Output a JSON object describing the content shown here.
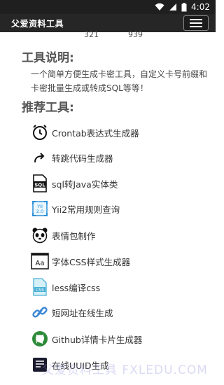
{
  "status": {
    "time": "4:02"
  },
  "appbar": {
    "title": "父爱资料工具"
  },
  "counts": [
    "321",
    "939"
  ],
  "intro": {
    "heading": "工具说明:",
    "text": "一个简单方便生成卡密工具，自定义卡号前缀和卡密批量生成或转成SQL等等！"
  },
  "tools_heading": "推荐工具:",
  "tools": [
    {
      "label": "Crontab表达式生成器",
      "icon": "clock-icon"
    },
    {
      "label": "转跳代码生成器",
      "icon": "redirect-arrow-icon"
    },
    {
      "label": "sql转Java实体类",
      "icon": "sql-file-icon"
    },
    {
      "label": "Yii2常用规则查询",
      "icon": "yii-icon"
    },
    {
      "label": "表情包制作",
      "icon": "panda-face-icon"
    },
    {
      "label": "字体CSS样式生成器",
      "icon": "font-aa-icon"
    },
    {
      "label": "less编译css",
      "icon": "css-file-icon"
    },
    {
      "label": "短网址在线生成",
      "icon": "link-icon"
    },
    {
      "label": "Github详情卡片生成器",
      "icon": "github-icon"
    },
    {
      "label": "在线UUID生成",
      "icon": "uuid-icon"
    }
  ],
  "watermark": "父爱资料工具 FXLEDU.COM"
}
